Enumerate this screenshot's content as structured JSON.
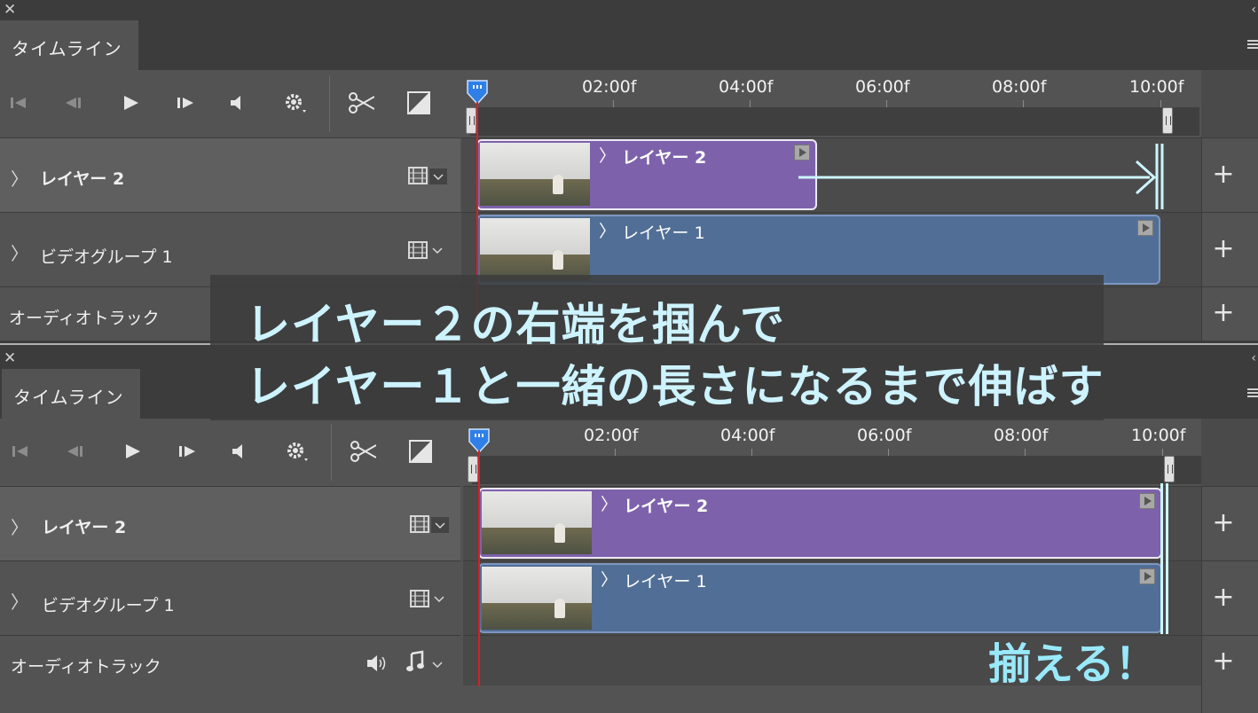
{
  "overlay": {
    "line1": "レイヤー２の右端を掴んで",
    "line2": "レイヤー１と一緒の長さになるまで伸ばす"
  },
  "annotation_bottom": "揃える！",
  "colors": {
    "purple_clip": "#7d62ab",
    "blue_clip": "#516f96",
    "playhead": "#d6202a",
    "annotation": "#99e9fb"
  },
  "panels": [
    {
      "close": "✕",
      "collapse": "‹",
      "tab": "タイムライン",
      "ruler": [
        "02:00f",
        "04:00f",
        "06:00f",
        "08:00f",
        "10:00f"
      ],
      "rows": [
        {
          "label": "レイヤー 2",
          "chev": "〉"
        },
        {
          "label": "ビデオグループ 1",
          "chev": "〉"
        },
        {
          "label": "オーディオトラック"
        }
      ],
      "clips": [
        {
          "name": "レイヤー 2",
          "chev": "〉"
        },
        {
          "name": "レイヤー 1",
          "chev": "〉"
        }
      ],
      "plus": [
        "+",
        "+",
        "+"
      ]
    },
    {
      "close": "✕",
      "collapse": "‹",
      "tab": "タイムライン",
      "ruler": [
        "02:00f",
        "04:00f",
        "06:00f",
        "08:00f",
        "10:00f"
      ],
      "rows": [
        {
          "label": "レイヤー 2",
          "chev": "〉"
        },
        {
          "label": "ビデオグループ 1",
          "chev": "〉"
        },
        {
          "label": "オーディオトラック"
        }
      ],
      "clips": [
        {
          "name": "レイヤー 2",
          "chev": "〉"
        },
        {
          "name": "レイヤー 1",
          "chev": "〉"
        }
      ],
      "plus": [
        "+",
        "+",
        "+"
      ]
    }
  ]
}
